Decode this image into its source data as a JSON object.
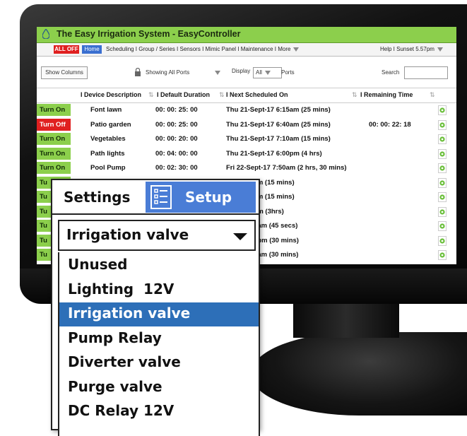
{
  "app": {
    "title": "The Easy Irrigation System  -  EasyController"
  },
  "nav": {
    "all_off": "ALL OFF",
    "home": "Home",
    "links": "Scheduling I Group / Series I Sensors I  Mimic Panel I Maintenance I More",
    "help": "Help I Sunset 5.57pm"
  },
  "toolbar": {
    "show_columns": "Show Columns",
    "ports_filter": "Showing All Ports",
    "display_label": "Display",
    "display_value": "All",
    "ports_label": "Ports",
    "search_label": "Search"
  },
  "table": {
    "headers": {
      "device": "I  Device Description",
      "duration": "I Default Duration",
      "next": "I   Next Scheduled On",
      "remaining": "I   Remaining Time"
    },
    "rows": [
      {
        "toggle": "Turn On",
        "state": "on",
        "device": "Font lawn",
        "duration": "00: 00: 25: 00",
        "next": "Thu 21-Sept-17 6:15am (25 mins)",
        "remaining": ""
      },
      {
        "toggle": "Turn Off",
        "state": "off",
        "device": "Patio garden",
        "duration": "00: 00: 25: 00",
        "next": "Thu 21-Sept-17 6:40am (25 mins)",
        "remaining": "00: 00: 22: 18"
      },
      {
        "toggle": "Turn On",
        "state": "on",
        "device": "Vegetables",
        "duration": "00: 00: 20: 00",
        "next": "Thu 21-Sept-17 7:10am (15 mins)",
        "remaining": ""
      },
      {
        "toggle": "Turn On",
        "state": "on",
        "device": "Path lights",
        "duration": "00: 04: 00: 00",
        "next": "Thu 21-Sept-17 6:00pm (4 hrs)",
        "remaining": ""
      },
      {
        "toggle": "Turn On",
        "state": "on",
        "device": "Pool Pump",
        "duration": "00: 02: 30: 00",
        "next": "Fri 22-Sept-17 7:50am  (2 hrs, 30 mins)",
        "remaining": ""
      },
      {
        "toggle": "Tu",
        "state": "on",
        "device": "",
        "duration": "",
        "next": "t-17 8:10am  (15 mins)",
        "remaining": ""
      },
      {
        "toggle": "Tu",
        "state": "on",
        "device": "",
        "duration": "",
        "next": "t-17 8:30am  (15 mins)",
        "remaining": ""
      },
      {
        "toggle": "Tu",
        "state": "on",
        "device": "",
        "duration": "",
        "next": "t-17 5:00pm  (3hrs)",
        "remaining": ""
      },
      {
        "toggle": "Tu",
        "state": "on",
        "device": "",
        "duration": "",
        "next": "pt-17 7:00am  (45 secs)",
        "remaining": ""
      },
      {
        "toggle": "Tu",
        "state": "on",
        "device": "",
        "duration": "",
        "next": "pt-17 6:00pm  (30 mins)",
        "remaining": ""
      },
      {
        "toggle": "Tu",
        "state": "on",
        "device": "",
        "duration": "",
        "next": "pt-17 9:00am  (30 mins)",
        "remaining": ""
      }
    ]
  },
  "overlay": {
    "settings": "Settings",
    "setup": "Setup",
    "selected_value": "Irrigation valve",
    "options": [
      "Unused",
      "Lighting  12V",
      "Irrigation valve",
      "Pump Relay",
      "Diverter valve",
      "Purge valve",
      "DC Relay 12V"
    ],
    "selected_index": 2
  },
  "colors": {
    "title_green": "#8ccf4c",
    "off_red": "#e02020",
    "home_blue": "#3a6fd0",
    "setup_blue": "#4a7dd6",
    "selected_blue": "#2d6fb8"
  },
  "icons": [
    "water-drop-icon",
    "lock-icon",
    "gear-icon",
    "checklist-icon",
    "chevron-down-icon"
  ]
}
